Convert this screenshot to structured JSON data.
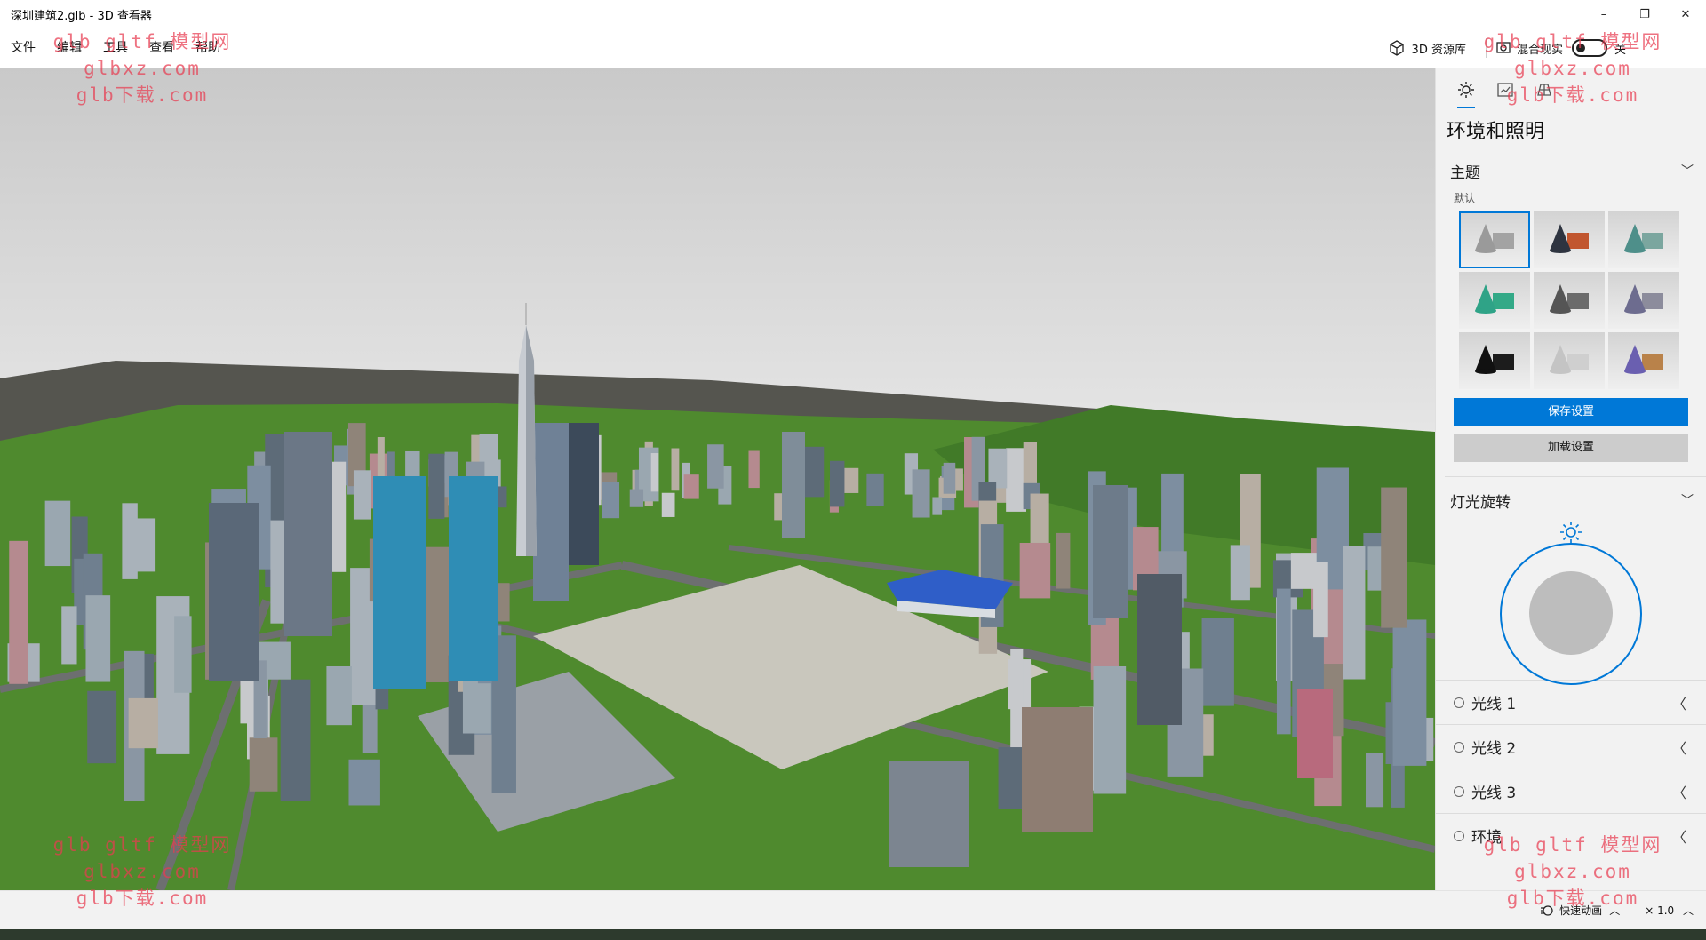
{
  "window": {
    "title": "深圳建筑2.glb - 3D 查看器",
    "minimize_glyph": "–",
    "maximize_glyph": "❐",
    "close_glyph": "✕"
  },
  "menu": {
    "items": [
      "文件",
      "编辑",
      "工具",
      "查看",
      "帮助"
    ],
    "library_label": "3D 资源库",
    "mixed_reality_label": "混合现实",
    "toggle_state_label": "关"
  },
  "panel": {
    "tabs": [
      "environment-icon",
      "stats-icon",
      "grid-icon"
    ],
    "title": "环境和照明",
    "theme_section": "主题",
    "theme_default_label": "默认",
    "save_button": "保存设置",
    "load_button": "加载设置",
    "light_rotation_section": "灯光旋转",
    "lights": [
      "光线 1",
      "光线 2",
      "光线 3",
      "环境"
    ],
    "themes": [
      {
        "bg": "#e6e6e6",
        "cone": "#9a9a9a",
        "box": "#a3a3a3",
        "selected": true
      },
      {
        "bg": "#e6e6e6",
        "cone": "#2e3440",
        "box": "#c1562f",
        "selected": false
      },
      {
        "bg": "#e6e6e6",
        "cone": "#4e8f8a",
        "box": "#7ba69f",
        "selected": false
      },
      {
        "bg": "#e6e6e6",
        "cone": "#2fa387",
        "box": "#33a987",
        "selected": false
      },
      {
        "bg": "#e6e6e6",
        "cone": "#555555",
        "box": "#6b6b6b",
        "selected": false
      },
      {
        "bg": "#e6e6e6",
        "cone": "#6d6c8f",
        "box": "#8c8c9c",
        "selected": false
      },
      {
        "bg": "#e6e6e6",
        "cone": "#111111",
        "box": "#1c1c1c",
        "selected": false
      },
      {
        "bg": "#e6e6e6",
        "cone": "#c4c4c4",
        "box": "#cfcfcf",
        "selected": false
      },
      {
        "bg": "#e6e6e6",
        "cone": "#6a5fb0",
        "box": "#b9824a",
        "selected": false
      }
    ]
  },
  "statusbar": {
    "animation_label": "快速动画",
    "speed_label": "× 1.0"
  },
  "watermark": {
    "line1": "glb gltf 模型网",
    "line2": "glbxz.com",
    "line3": "glb下载.com"
  },
  "colors": {
    "accent": "#0078d7",
    "ground_grass": "#4f8a2e",
    "ground_base": "#5a5a55",
    "watermark": "#e83c50"
  }
}
